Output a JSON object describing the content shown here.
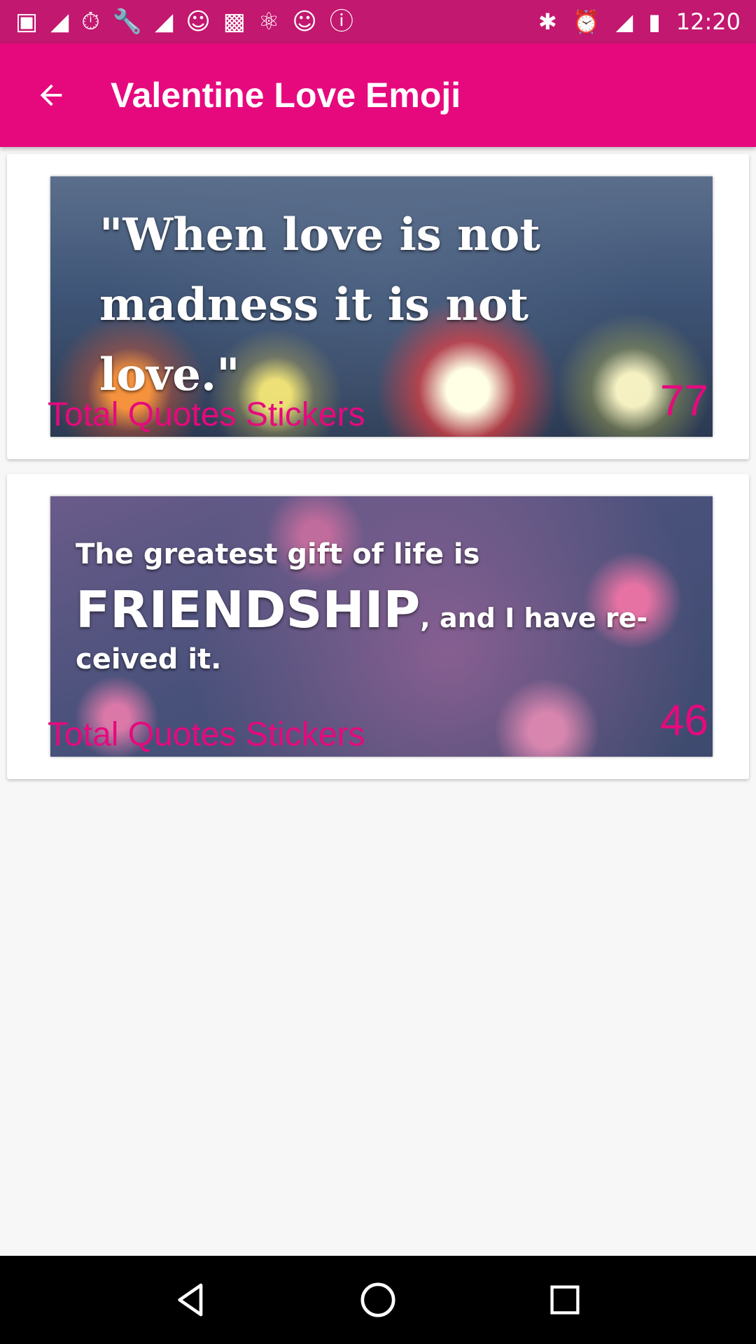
{
  "status_bar": {
    "time": "12:20",
    "left_icons": [
      "chat-icon",
      "flipboard-icon",
      "timer-icon",
      "wrench-icon",
      "flipboard-icon",
      "smiley-icon",
      "qt-icon",
      "translate-icon",
      "smiley-icon",
      "info-icon"
    ],
    "right_icons": [
      "bluetooth-icon",
      "alarm-icon",
      "signal-icon",
      "battery-icon"
    ]
  },
  "app_bar": {
    "title": "Valentine Love Emoji",
    "color": "#e6097e"
  },
  "cards": [
    {
      "quote_line1": "\"When love is not",
      "quote_line2": "madness it is not love.\"",
      "quote_line3": "‚",
      "label": "Total Quotes Stickers",
      "count": "77"
    },
    {
      "quote_line1": "The greatest gift of life is",
      "quote_big": "FRIENDSHIP",
      "quote_small": ", and I have re-",
      "quote_line3": "ceived it.",
      "label": "Total Quotes Stickers",
      "count": "46"
    }
  ],
  "nav_bar": {
    "buttons": [
      "back-icon",
      "home-icon",
      "recents-icon"
    ]
  }
}
